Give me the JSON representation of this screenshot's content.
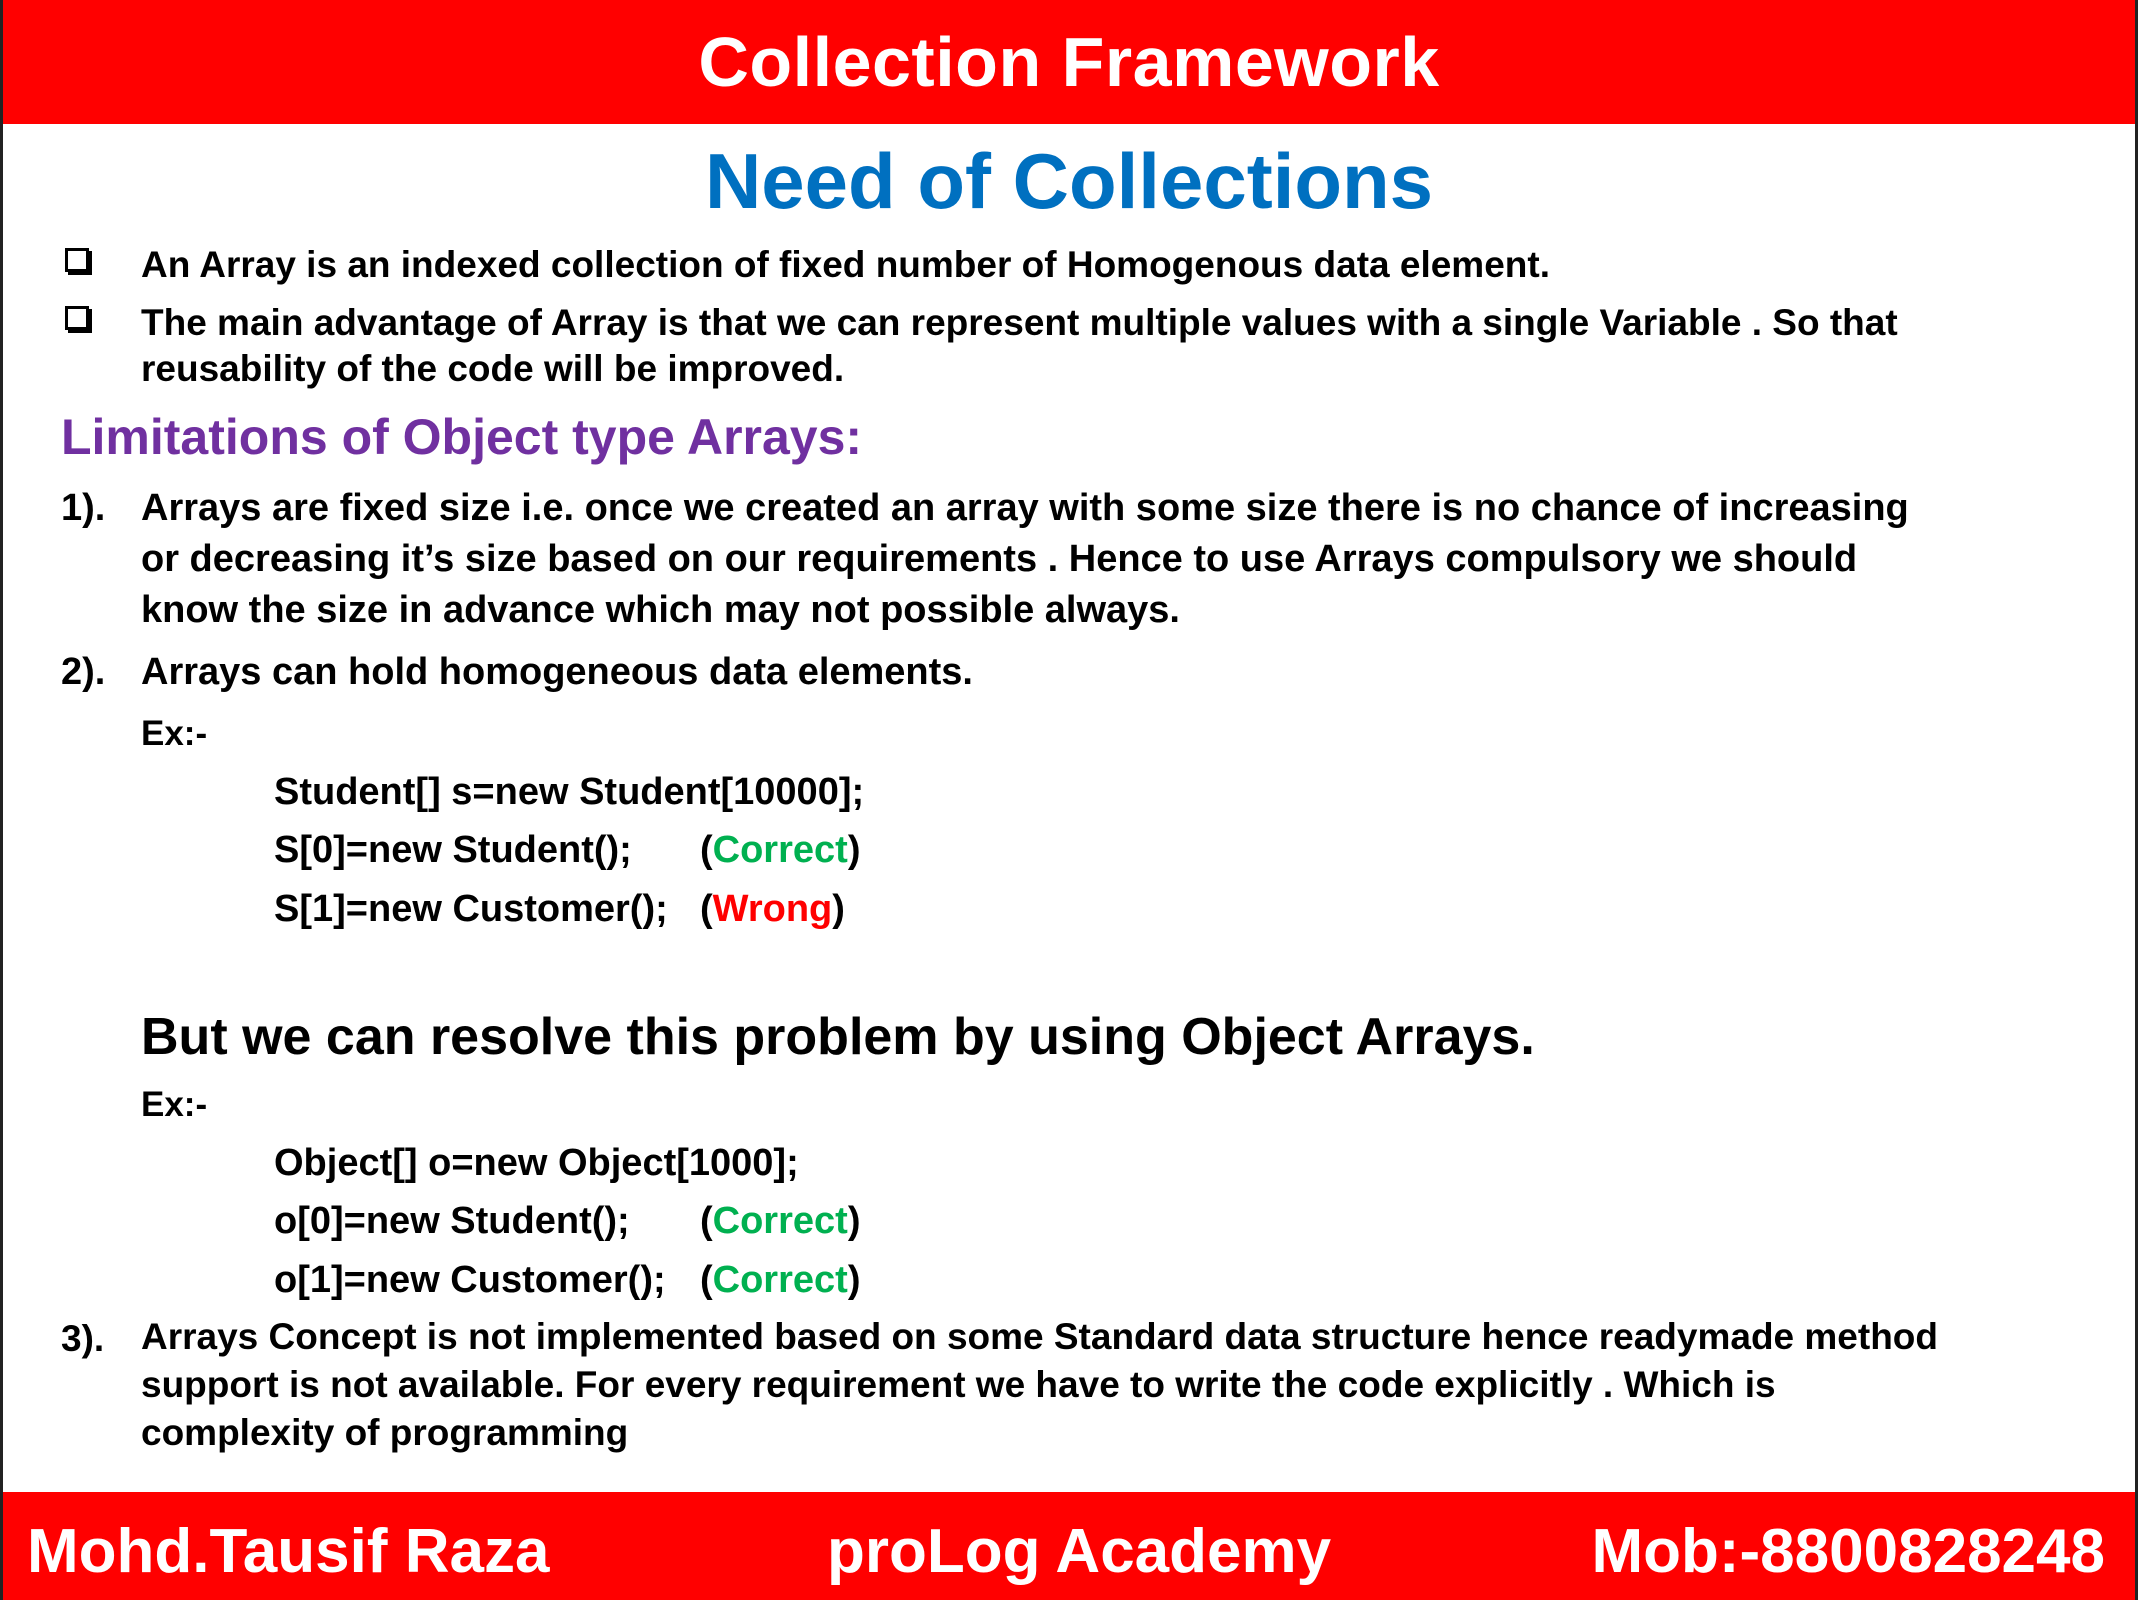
{
  "header": {
    "title": "Collection Framework"
  },
  "subtitle": "Need of Collections",
  "bullets": [
    {
      "lines": [
        "An Array is an indexed collection of fixed number of Homogenous data element."
      ]
    },
    {
      "lines": [
        "The main advantage of Array is that we can represent multiple values with a single Variable . So that",
        "reusability of the code will be improved."
      ]
    }
  ],
  "limitations_heading": "Limitations of Object type Arrays:",
  "items": [
    {
      "num": "1).",
      "lines": [
        "Arrays are fixed size i.e. once we created an array with some size there is no chance of increasing",
        "or decreasing it’s size based on our requirements . Hence to use Arrays compulsory we should",
        "know the size in advance which may not possible always."
      ]
    },
    {
      "num": "2).",
      "lines": [
        "Arrays can hold homogeneous data elements."
      ]
    },
    {
      "num": "3).",
      "lines": [
        "Arrays Concept is not implemented based on some Standard data structure hence  readymade method",
        "support is not available. For every  requirement  we have to write the code explicitly . Which is",
        "complexity of programming"
      ]
    }
  ],
  "example1": {
    "label": "Ex:-",
    "code": [
      "Student[] s=new Student[10000];",
      "S[0]=new Student();",
      "S[1]=new  Customer();"
    ],
    "results": [
      {
        "open": "(",
        "word": "Correct",
        "close": ")"
      },
      {
        "open": "(",
        "word": "Wrong",
        "close": ")"
      }
    ]
  },
  "resolve_line": "But we can resolve this problem by using Object Arrays.",
  "example2": {
    "label": "Ex:-",
    "code": [
      "Object[] o=new Object[1000];",
      "o[0]=new Student();",
      "o[1]=new  Customer();"
    ],
    "results": [
      {
        "open": "(",
        "word": "Correct",
        "close": ")"
      },
      {
        "open": "(",
        "word": "Correct",
        "close": ")"
      }
    ]
  },
  "footer": {
    "left": "Mohd.Tausif Raza",
    "center": "proLog Academy",
    "right": "Mob:-8800828248"
  },
  "colors": {
    "bar": "#ff0000",
    "subtitle": "#0070c0",
    "heading": "#7030a0",
    "correct": "#00b050",
    "wrong": "#ff0000"
  }
}
